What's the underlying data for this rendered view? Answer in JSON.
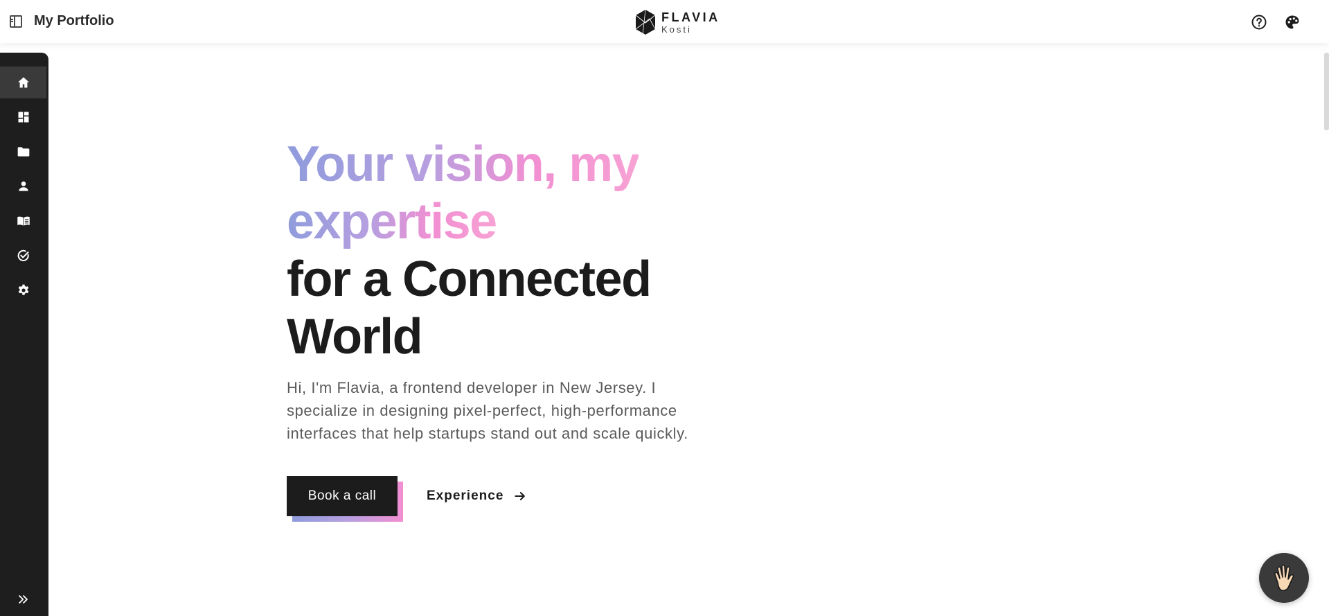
{
  "header": {
    "title": "My Portfolio",
    "brand_name": "FLAVIA",
    "brand_sub": "Kosti",
    "icons": [
      "panel-toggle-icon",
      "help-icon",
      "palette-icon"
    ]
  },
  "sidebar": {
    "items": [
      {
        "name": "home",
        "icon": "home-icon",
        "active": true
      },
      {
        "name": "dashboard",
        "icon": "dashboard-icon",
        "active": false
      },
      {
        "name": "projects",
        "icon": "folder-icon",
        "active": false
      },
      {
        "name": "about",
        "icon": "person-icon",
        "active": false
      },
      {
        "name": "blog",
        "icon": "book-icon",
        "active": false
      },
      {
        "name": "tasks",
        "icon": "check-circle-icon",
        "active": false
      },
      {
        "name": "settings",
        "icon": "gear-icon",
        "active": false
      }
    ],
    "expand_icon": "double-chevron-right-icon"
  },
  "hero": {
    "title_grad_1": "Your vision, my",
    "title_grad_2": "expertise",
    "title_dark_1": "for a Connected",
    "title_dark_2": "World",
    "intro": "Hi, I'm Flavia, a frontend developer in New Jersey. I specialize in designing pixel-perfect, high-performance interfaces that help startups stand out and scale quickly.",
    "cta_primary": "Book a call",
    "cta_secondary": "Experience"
  },
  "floating": {
    "icon": "waving-hand-icon"
  },
  "colors": {
    "sidebar_bg": "#1e1e1e",
    "text_dark": "#1c1c1c",
    "gradient_start": "#8f9cdc",
    "gradient_end": "#f7a2d4"
  }
}
